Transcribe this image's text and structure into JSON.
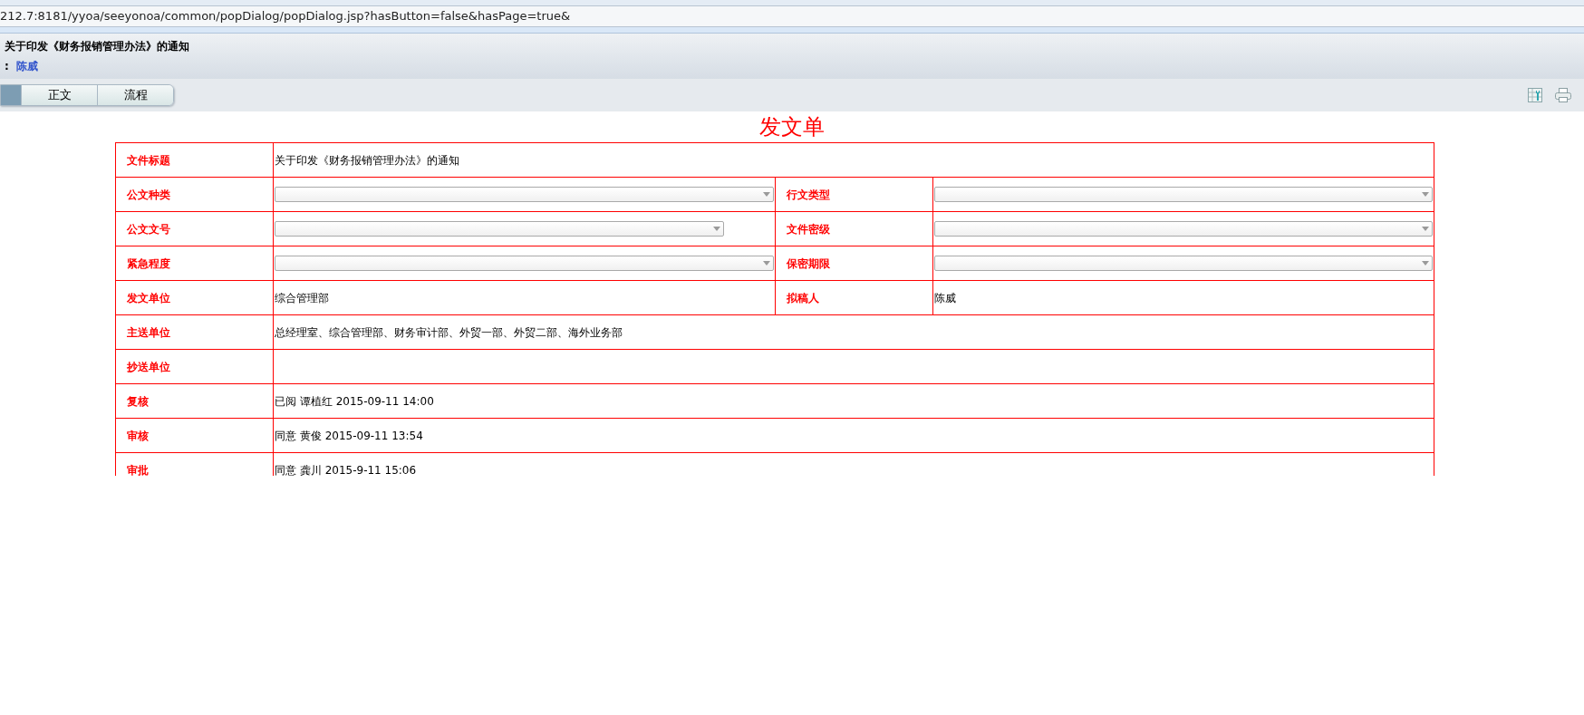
{
  "address_bar": {
    "url": "212.7:8181/yyoa/seeyonoa/common/popDialog/popDialog.jsp?hasButton=false&hasPage=true&"
  },
  "header": {
    "title": "关于印发《财务报销管理办法》的通知",
    "author_separator": ":",
    "author": "陈威"
  },
  "tabs": [
    {
      "label": "正文",
      "selected": false
    },
    {
      "label": "流程",
      "selected": false
    }
  ],
  "form": {
    "title": "发文单",
    "rows": [
      {
        "cells": [
          {
            "label": "文件标题",
            "kind": "text",
            "value": "关于印发《财务报销管理办法》的通知"
          }
        ]
      },
      {
        "cells": [
          {
            "label": "公文种类",
            "kind": "select",
            "full": true
          },
          {
            "label": "行文类型",
            "kind": "select",
            "full": true
          }
        ]
      },
      {
        "cells": [
          {
            "label": "公文文号",
            "kind": "select",
            "full": false
          },
          {
            "label": "文件密级",
            "kind": "select",
            "full": true
          }
        ]
      },
      {
        "cells": [
          {
            "label": "紧急程度",
            "kind": "select",
            "full": true
          },
          {
            "label": "保密期限",
            "kind": "select",
            "full": true
          }
        ]
      },
      {
        "cells": [
          {
            "label": "发文单位",
            "kind": "text",
            "value": "综合管理部"
          },
          {
            "label": "拟稿人",
            "kind": "text",
            "value": "陈威"
          }
        ]
      },
      {
        "cells": [
          {
            "label": "主送单位",
            "kind": "text",
            "value": "总经理室、综合管理部、财务审计部、外贸一部、外贸二部、海外业务部"
          }
        ]
      },
      {
        "cells": [
          {
            "label": "抄送单位",
            "kind": "text"
          }
        ]
      },
      {
        "cells": [
          {
            "label": "复核",
            "kind": "text",
            "value": "已阅 谭植红 2015-09-11 14:00"
          }
        ]
      },
      {
        "cells": [
          {
            "label": "审核",
            "kind": "text",
            "value": "同意 黄俊 2015-09-11 13:54"
          }
        ]
      },
      {
        "cells": [
          {
            "label": "审批",
            "kind": "text",
            "value": "同意 龚川 2015-9-11 15:06"
          }
        ]
      }
    ]
  }
}
